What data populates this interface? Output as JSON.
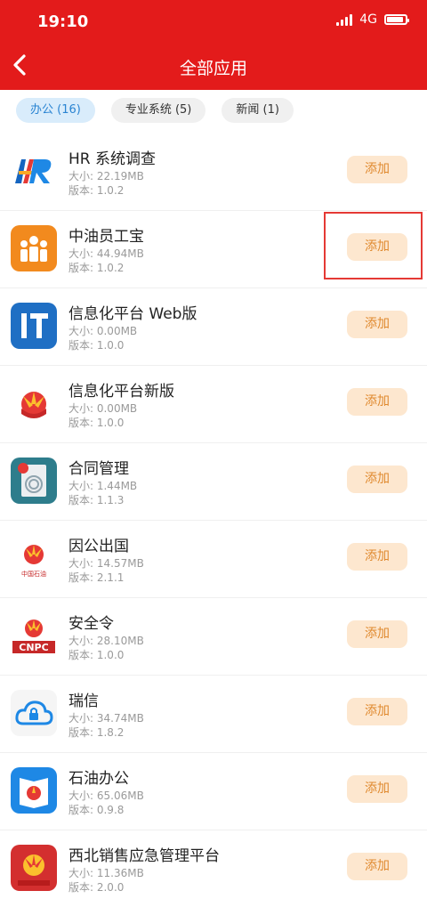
{
  "status": {
    "time": "19:10",
    "network": "4G"
  },
  "header": {
    "title": "全部应用"
  },
  "tabs": [
    {
      "label": "办公 (16)",
      "active": true
    },
    {
      "label": "专业系统 (5)",
      "active": false
    },
    {
      "label": "新闻 (1)",
      "active": false
    }
  ],
  "apps": [
    {
      "name": "HR 系统调查",
      "size": "大小: 22.19MB",
      "version": "版本: 1.0.2",
      "button": "添加",
      "icon": "hr-logo-icon"
    },
    {
      "name": "中油员工宝",
      "size": "大小: 44.94MB",
      "version": "版本: 1.0.2",
      "button": "添加",
      "icon": "employee-icon"
    },
    {
      "name": "信息化平台 Web版",
      "size": "大小: 0.00MB",
      "version": "版本: 1.0.0",
      "button": "添加",
      "icon": "it-icon"
    },
    {
      "name": "信息化平台新版",
      "size": "大小: 0.00MB",
      "version": "版本: 1.0.0",
      "button": "添加",
      "icon": "petrochina-logo-icon"
    },
    {
      "name": "合同管理",
      "size": "大小: 1.44MB",
      "version": "版本: 1.1.3",
      "button": "添加",
      "icon": "contract-icon"
    },
    {
      "name": "因公出国",
      "size": "大小: 14.57MB",
      "version": "版本: 2.1.1",
      "button": "添加",
      "icon": "petrochina-logo-icon",
      "icon_text": "中国石油"
    },
    {
      "name": "安全令",
      "size": "大小: 28.10MB",
      "version": "版本: 1.0.0",
      "button": "添加",
      "icon": "cnpc-logo-icon",
      "icon_text": "CNPC"
    },
    {
      "name": "瑞信",
      "size": "大小: 34.74MB",
      "version": "版本: 1.8.2",
      "button": "添加",
      "icon": "cloud-lock-icon"
    },
    {
      "name": "石油办公",
      "size": "大小: 65.06MB",
      "version": "版本: 0.9.8",
      "button": "添加",
      "icon": "book-icon"
    },
    {
      "name": "西北销售应急管理平台",
      "size": "大小: 11.36MB",
      "version": "版本: 2.0.0",
      "button": "添加",
      "icon": "petrochina-red-icon"
    }
  ],
  "colors": {
    "header": "#e31b1b",
    "tab_active_bg": "#d9ecfb",
    "tab_active_text": "#2a84d2",
    "add_bg": "#fde7cf",
    "add_text": "#e08a2f",
    "highlight": "#e53935"
  }
}
